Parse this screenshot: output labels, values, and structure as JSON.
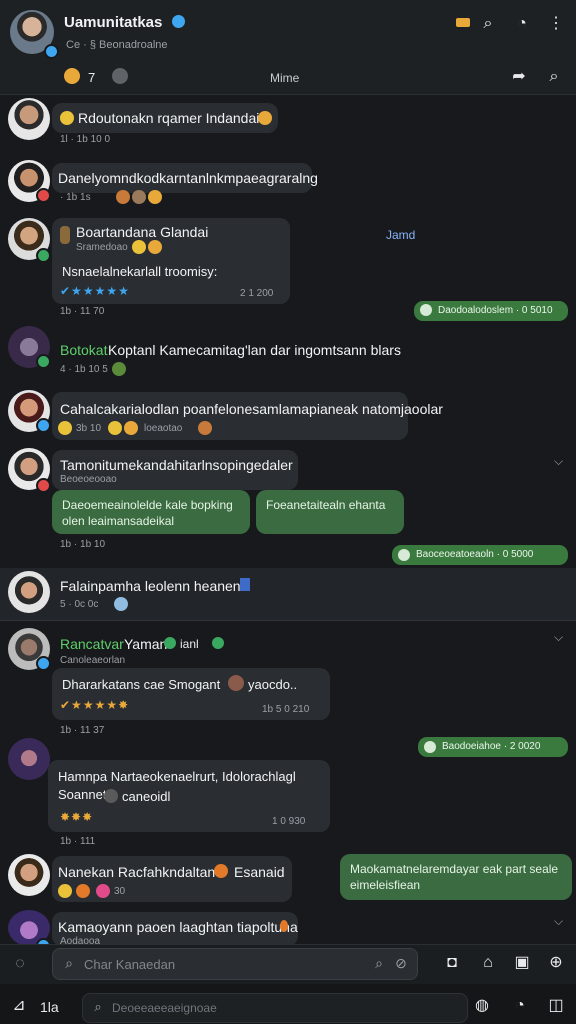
{
  "header": {
    "title": "Uamunitatkas",
    "subtitle": "Ce  · §  Beonadroalne",
    "count_label": "7",
    "center_label": "Mime",
    "accent": "#3ea6f0"
  },
  "messages": [
    {
      "text": "Rdoutonakn rqamer Indandai",
      "meta": "1l · 1b 10 0"
    },
    {
      "text": "Danelyomndkodkarntanlnkmpaeagraralng",
      "meta": "· 1b 1s"
    },
    {
      "name": "Boartandana Glandai",
      "sub": "Sramedoao",
      "body": "Nsnaelalnekarlall troomisy:",
      "time": "2 1 200",
      "side_label": "Jamd"
    },
    {
      "pill": "Daodoalodoslem · 0 5010"
    },
    {
      "name": "Botokat",
      "text": "Koptanl Kamecamitag'lan dar ingomtsann blars",
      "meta": "4 · 1b 10 5"
    },
    {
      "text": "Cahalcakarialodlan poanfelonesamlamapianeak natomjaoolar",
      "meta": "3b 10",
      "meta2": "loeaotao"
    },
    {
      "text": "Tamonitumekandahitarlnsopingedaler",
      "sub": "Beoeoeooao",
      "bubble1": "Daeoemeainolelde kale bopking olen leaimansadeikal",
      "bubble2": "Foeanetaitealn ehanta",
      "meta": "1b · 1b 10"
    },
    {
      "pill": "Baoceoeatoeaoln · 0 5000"
    },
    {
      "text": "Falainpamha leolenn heanen",
      "meta": "5 · 0c 0c"
    },
    {
      "name": "Rancatvar",
      "name2": "Yaman",
      "extra": "ianl",
      "sub": "Canoleaeorlan",
      "body": "Dhararkatans cae Smogant",
      "body2": "yaocdo..",
      "time": "1b 5 0 210",
      "meta": "1b · 11 37"
    },
    {
      "pill": "Baodoeiahoe · 2 0020"
    },
    {
      "text": "Hamnpa Nartaeokenaelrurt, Idolorachlagl Soannet",
      "text2": "caneoidl",
      "time": "1 0 930",
      "meta": "1b · 111"
    },
    {
      "text": "Nanekan Racfahkndaltan",
      "extra": "Esanaid",
      "meta": "30"
    },
    {
      "bubble": "Maokamatnelaremdayar eak part seale eimeleisfiean"
    },
    {
      "text": "Kamaoyann paoen laaghtan tiapoltuna",
      "meta": "Aodaooa"
    }
  ],
  "composer": {
    "placeholder": "Char Kanaedan",
    "bottom_placeholder": "Deoeeaeeaeignoae",
    "bottom_label": "1la"
  },
  "icons": [
    "lock-icon",
    "search-icon",
    "chat-icon",
    "more-icon",
    "share-icon",
    "reaction-icon",
    "attach-icon",
    "gift-icon",
    "camera-icon",
    "send-icon",
    "compose-icon",
    "emoji-icon"
  ]
}
